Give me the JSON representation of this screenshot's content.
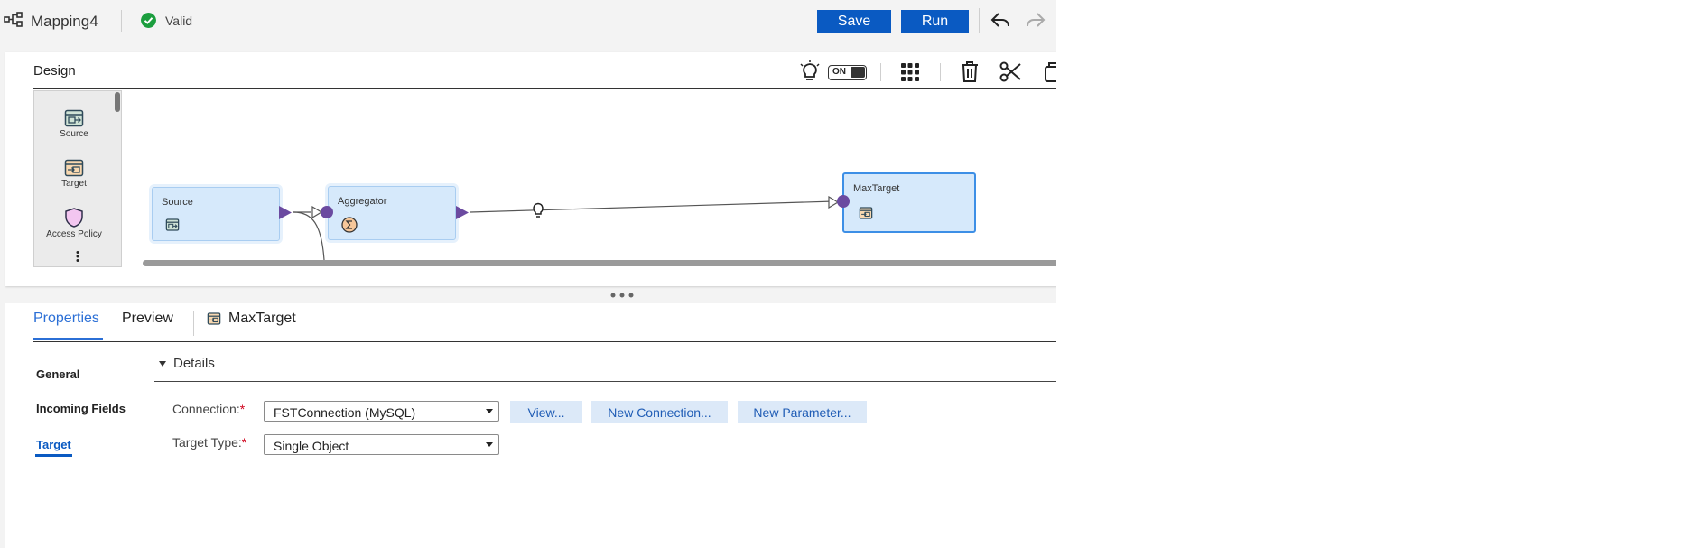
{
  "header": {
    "mapping_name": "Mapping4",
    "status": "Valid",
    "save_label": "Save",
    "run_label": "Run",
    "icons": [
      "mapping-icon",
      "check-circle-icon",
      "undo-icon",
      "redo-icon"
    ]
  },
  "design": {
    "title": "Design",
    "toggle_label": "ON",
    "toolbar_icons": [
      "lightbulb-icon",
      "grid-icon",
      "trash-icon",
      "scissors-icon",
      "copy-icon"
    ],
    "palette": {
      "items": [
        {
          "label": "Source",
          "icon": "source-icon"
        },
        {
          "label": "Target",
          "icon": "target-icon"
        },
        {
          "label": "Access Policy",
          "icon": "shield-icon"
        }
      ]
    },
    "nodes": [
      {
        "label": "Source",
        "icon": "source-icon"
      },
      {
        "label": "Aggregator",
        "icon": "sigma-icon"
      },
      {
        "label": "MaxTarget",
        "icon": "target-icon",
        "selected": true
      }
    ]
  },
  "properties": {
    "tabs": [
      "Properties",
      "Preview"
    ],
    "active_tab": "Properties",
    "object_name": "MaxTarget",
    "side_nav": [
      "General",
      "Incoming Fields",
      "Target"
    ],
    "active_side": "Target",
    "section_title": "Details",
    "fields": {
      "connection_label": "Connection:",
      "connection_value": "FSTConnection (MySQL)",
      "target_type_label": "Target Type:",
      "target_type_value": "Single Object"
    },
    "buttons": {
      "view": "View...",
      "new_connection": "New Connection...",
      "new_parameter": "New Parameter..."
    }
  },
  "colors": {
    "primary": "#0a5ac2",
    "link": "#2b6fd6",
    "node_fill": "#d6e9fb",
    "port": "#6b4aa0",
    "valid": "#1b9e3e"
  }
}
